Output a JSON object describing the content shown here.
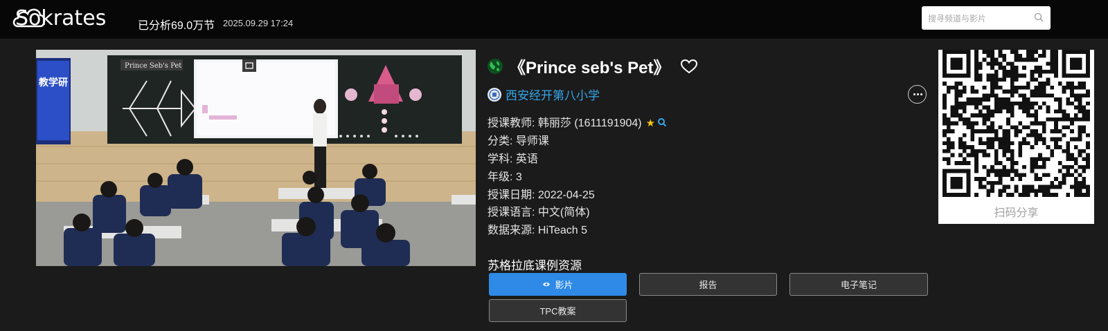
{
  "header": {
    "brand": "Sokrates",
    "analyzed_stat": "已分析69.0万节",
    "timestamp": "2025.09.29 17:24",
    "search_placeholder": "搜寻频道与影片"
  },
  "lesson": {
    "title": "《Prince seb's Pet》",
    "school": "西安经开第八小学",
    "details": [
      {
        "label": "授课教师:",
        "value": " 韩丽莎 (1611191904)"
      },
      {
        "label": "分类:",
        "value": " 导师课"
      },
      {
        "label": "学科:",
        "value": " 英语"
      },
      {
        "label": "年级:",
        "value": " 3"
      },
      {
        "label": "授课日期:",
        "value": " 2022-04-25"
      },
      {
        "label": "授课语言:",
        "value": " 中文(简体)"
      },
      {
        "label": "数据来源:",
        "value": " HiTeach 5"
      }
    ]
  },
  "resources": {
    "title": "苏格拉底课例资源",
    "buttons": [
      {
        "label": "影片",
        "active": true
      },
      {
        "label": "报告",
        "active": false
      },
      {
        "label": "电子笔记",
        "active": false
      },
      {
        "label": "TPC教案",
        "active": false
      }
    ]
  },
  "share": {
    "label": "扫码分享"
  },
  "video_scene": {
    "board_title": "Prince Seb's Pet",
    "side_label": "教学研"
  },
  "colors": {
    "accent": "#2e8ae6",
    "link": "#35a7ec",
    "star": "#f5c518",
    "globe": "#1f9d3a"
  }
}
